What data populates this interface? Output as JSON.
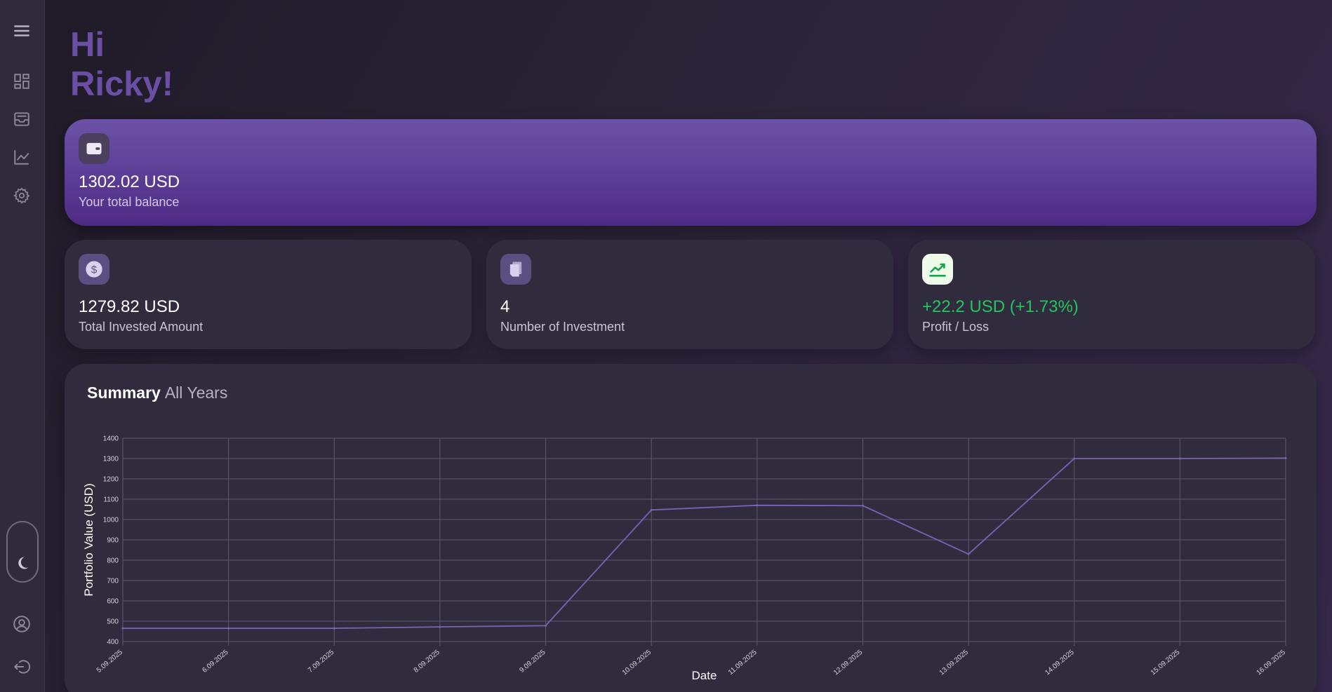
{
  "sidebar": {
    "items": [
      {
        "name": "menu-icon"
      },
      {
        "name": "dashboard-icon"
      },
      {
        "name": "inbox-icon"
      },
      {
        "name": "chart-icon"
      },
      {
        "name": "settings-icon"
      }
    ],
    "theme_toggle_icon": "moon-icon",
    "bottom": [
      {
        "name": "profile-icon"
      },
      {
        "name": "logout-icon"
      }
    ]
  },
  "greeting": {
    "line1": "Hi",
    "line2": "Ricky!"
  },
  "balance": {
    "value": "1302.02 USD",
    "label": "Your total balance",
    "icon": "wallet-icon"
  },
  "stats": [
    {
      "value": "1279.82 USD",
      "label": "Total Invested Amount",
      "icon": "dollar-icon"
    },
    {
      "value": "4",
      "label": "Number of Investment",
      "icon": "documents-icon"
    },
    {
      "value": "+22.2 USD (+1.73%)",
      "label": "Profit / Loss",
      "icon": "trend-up-icon"
    }
  ],
  "colors": {
    "accent": "#6b4fa5",
    "profit": "#22c55e",
    "line": "#7b62b8"
  },
  "summary": {
    "title": "Summary",
    "subtitle": "All Years"
  },
  "chart_data": {
    "type": "line",
    "xlabel": "Date",
    "ylabel": "Portfolio Value (USD)",
    "ylim": [
      400,
      1400
    ],
    "yticks": [
      400,
      500,
      600,
      700,
      800,
      900,
      1000,
      1100,
      1200,
      1300,
      1400
    ],
    "grid": true,
    "categories": [
      "5.09.2025",
      "6.09.2025",
      "7.09.2025",
      "8.09.2025",
      "9.09.2025",
      "10.09.2025",
      "11.09.2025",
      "12.09.2025",
      "13.09.2025",
      "14.09.2025",
      "15.09.2025",
      "16.09.2025"
    ],
    "series": [
      {
        "values": [
          465,
          465,
          465,
          472,
          478,
          1047,
          1070,
          1068,
          830,
          1300,
          1300,
          1302
        ]
      }
    ]
  }
}
